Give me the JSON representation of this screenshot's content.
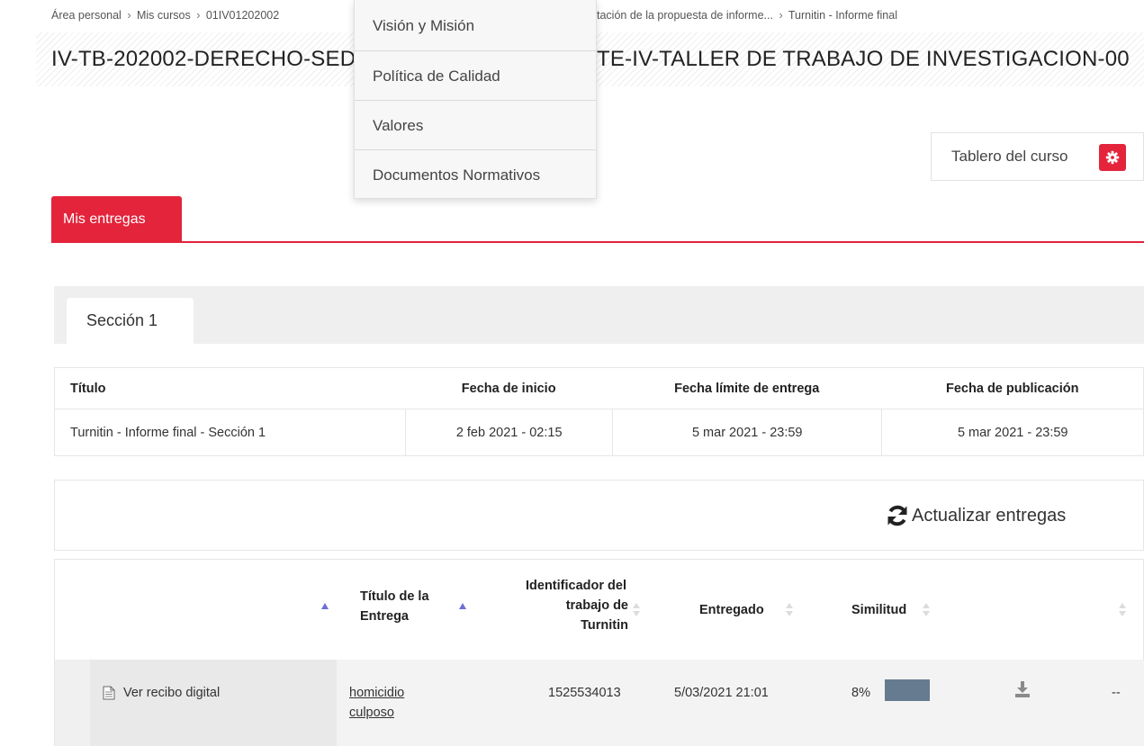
{
  "breadcrumb": {
    "items": [
      "Área personal",
      "Mis cursos",
      "01IV01202002",
      "tación de la propuesta de informe...",
      "Turnitin - Informe final"
    ],
    "separator": "›"
  },
  "course_title": "IV-TB-202002-DERECHO-SED",
  "course_title_suffix": "TE-IV-TALLER DE TRABAJO DE INVESTIGACION-00",
  "dropdown": {
    "items": [
      "Visión y Misión",
      "Política de Calidad",
      "Valores",
      "Documentos Normativos"
    ]
  },
  "dashboard_button": {
    "label": "Tablero del curso",
    "icon": "gear-icon"
  },
  "tabs": [
    {
      "label": "Mis entregas",
      "active": true
    }
  ],
  "section_tab": "Sección 1",
  "info_table": {
    "headers": [
      "Título",
      "Fecha de inicio",
      "Fecha límite de entrega",
      "Fecha de publicación"
    ],
    "row": [
      "Turnitin - Informe final - Sección 1",
      "2 feb 2021 - 02:15",
      "5 mar 2021 - 23:59",
      "5 mar 2021 - 23:59"
    ]
  },
  "refresh_label": "Actualizar entregas",
  "submissions": {
    "headers": {
      "title_l1": "Título de la",
      "title_l2": "Entrega",
      "id_l1": "Identificador del",
      "id_l2": "trabajo de",
      "id_l3": "Turnitin",
      "submitted": "Entregado",
      "similarity": "Similitud"
    },
    "row": {
      "receipt": "Ver recibo digital",
      "title_l1": "homicidio",
      "title_l2": "culposo",
      "paper_id": "1525534013",
      "submitted": "5/03/2021 21:01",
      "similarity": "8%",
      "grade": "--"
    }
  },
  "colors": {
    "accent": "#e3243b",
    "similarity_bar": "#667b8f",
    "sort_active": "#6e6fd6"
  }
}
